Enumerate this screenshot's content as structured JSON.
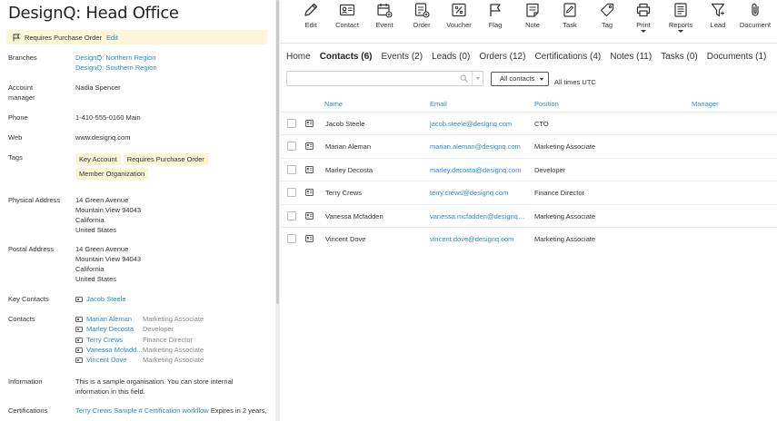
{
  "record": {
    "title": "DesignQ: Head Office",
    "banner": {
      "text": "Requires Purchase Order",
      "edit_label": "Edit"
    }
  },
  "details": {
    "branches_label": "Branches",
    "branches": [
      "DesignQ: Northern Region",
      "DesignQ: Southern Region"
    ],
    "account_manager_label_1": "Account",
    "account_manager_label_2": "manager",
    "account_manager": "Nadia Spencer",
    "phone_label": "Phone",
    "phone": "1-410-555-0160 Main",
    "web_label": "Web",
    "web": "www.designq.com",
    "tags_label": "Tags",
    "tags": [
      "Key Account",
      "Requires Purchase Order",
      "Member Organization"
    ],
    "physical_label": "Physical Address",
    "physical": [
      "14 Green Avenue",
      "Mountain View 94043",
      "California",
      "United States"
    ],
    "postal_label": "Postal Address",
    "postal": [
      "14 Green Avenue",
      "Mountain View 94043",
      "California",
      "United States"
    ],
    "key_contacts_label": "Key Contacts",
    "key_contact": "Jacob Steele",
    "contacts_label": "Contacts",
    "contacts": [
      {
        "name": "Marian Aleman",
        "position": "Marketing Associate"
      },
      {
        "name": "Marley Decosta",
        "position": "Developer"
      },
      {
        "name": "Terry Crews",
        "position": "Finance Director"
      },
      {
        "name": "Vanessa Mcfadd...",
        "position": "Marketing Associate"
      },
      {
        "name": "Vincent Dove",
        "position": "Marketing Associate"
      }
    ],
    "information_label": "Information",
    "information": [
      "This is a sample organisation. You can store internal",
      "information in this field."
    ],
    "certifications_label": "Certifications",
    "certification_link": "Terry Crews Sample # Certification workflow",
    "certification_note": "Expires in 2 years,"
  },
  "toolbar": {
    "buttons": [
      {
        "label": "Edit",
        "icon": "pencil-icon"
      },
      {
        "label": "Contact",
        "icon": "contact-card-icon"
      },
      {
        "label": "Event",
        "icon": "calendar-add-icon"
      },
      {
        "label": "Order",
        "icon": "order-icon"
      },
      {
        "label": "Voucher",
        "icon": "percent-voucher-icon"
      },
      {
        "label": "Flag",
        "icon": "flag-icon"
      },
      {
        "label": "Note",
        "icon": "note-icon"
      },
      {
        "label": "Task",
        "icon": "task-icon"
      },
      {
        "label": "Tag",
        "icon": "tag-icon"
      },
      {
        "label": "Print",
        "icon": "printer-icon"
      },
      {
        "label": "Reports",
        "icon": "reports-icon"
      },
      {
        "label": "Lead",
        "icon": "funnel-icon"
      },
      {
        "label": "Document",
        "icon": "paperclip-icon"
      }
    ]
  },
  "tabs": [
    {
      "label": "Home"
    },
    {
      "label": "Contacts (6)"
    },
    {
      "label": "Events (2)"
    },
    {
      "label": "Leads (0)"
    },
    {
      "label": "Orders (12)"
    },
    {
      "label": "Certifications (4)"
    },
    {
      "label": "Notes (11)"
    },
    {
      "label": "Tasks (0)"
    },
    {
      "label": "Documents (1)"
    }
  ],
  "search": {
    "placeholder": "",
    "value": ""
  },
  "filter": {
    "selected": "All contacts"
  },
  "timezone_note": "All times UTC",
  "table": {
    "headers": {
      "name": "Name",
      "email": "Email",
      "position": "Position",
      "manager": "Manager"
    },
    "rows": [
      {
        "name": "Jacob Steele",
        "email": "jacob.steele@designq.com",
        "position": "CTO"
      },
      {
        "name": "Marian Aleman",
        "email": "marian.aleman@designq.com",
        "position": "Marketing Associate"
      },
      {
        "name": "Marley Decosta",
        "email": "marley.decosta@designq.com",
        "position": "Developer"
      },
      {
        "name": "Terry Crews",
        "email": "terry.crews@designq.com",
        "position": "Finance Director"
      },
      {
        "name": "Vanessa Mcfadden",
        "email": "vanessa.mcfadden@designq.com",
        "position": "Marketing Associate"
      },
      {
        "name": "Vincent Dove",
        "email": "vincent.dove@designq.com",
        "position": "Marketing Associate"
      }
    ]
  },
  "colors": {
    "link": "#2a8bc9",
    "tag_bg": "#fdf6d6"
  }
}
